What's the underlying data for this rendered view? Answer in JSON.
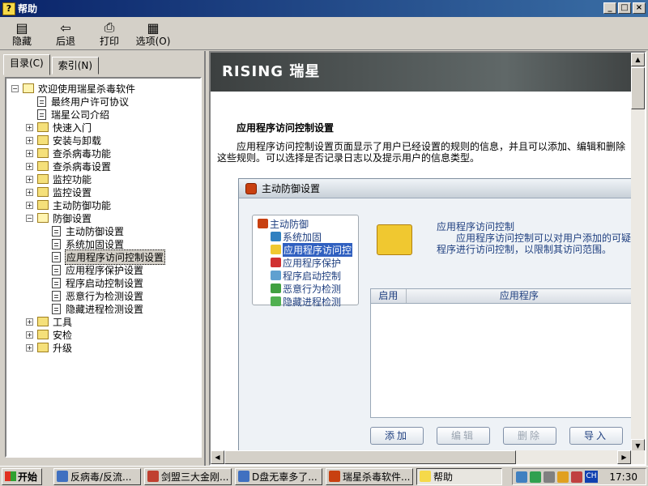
{
  "window": {
    "title": "帮助",
    "min": "_",
    "max": "□",
    "close": "×"
  },
  "toolbar": [
    {
      "label": "隐藏",
      "icon": "hide-icon"
    },
    {
      "label": "后退",
      "icon": "back-arrow-icon"
    },
    {
      "label": "打印",
      "icon": "printer-icon"
    },
    {
      "label": "选项(O)",
      "icon": "options-icon"
    }
  ],
  "tabs": [
    {
      "label": "目录(C)",
      "active": true
    },
    {
      "label": "索引(N)",
      "active": false
    }
  ],
  "tree": [
    {
      "level": 0,
      "type": "folder",
      "expander": "−",
      "open": true,
      "label": "欢迎使用瑞星杀毒软件"
    },
    {
      "level": 1,
      "type": "doc",
      "label": "最终用户许可协议"
    },
    {
      "level": 1,
      "type": "doc",
      "label": "瑞星公司介绍"
    },
    {
      "level": 1,
      "type": "folder",
      "expander": "+",
      "label": "快速入门"
    },
    {
      "level": 1,
      "type": "folder",
      "expander": "+",
      "label": "安装与卸载"
    },
    {
      "level": 1,
      "type": "folder",
      "expander": "+",
      "label": "查杀病毒功能"
    },
    {
      "level": 1,
      "type": "folder",
      "expander": "+",
      "label": "查杀病毒设置"
    },
    {
      "level": 1,
      "type": "folder",
      "expander": "+",
      "label": "监控功能"
    },
    {
      "level": 1,
      "type": "folder",
      "expander": "+",
      "label": "监控设置"
    },
    {
      "level": 1,
      "type": "folder",
      "expander": "+",
      "label": "主动防御功能"
    },
    {
      "level": 1,
      "type": "folder",
      "expander": "−",
      "open": true,
      "label": "防御设置"
    },
    {
      "level": 2,
      "type": "doc",
      "label": "主动防御设置"
    },
    {
      "level": 2,
      "type": "doc",
      "label": "系统加固设置"
    },
    {
      "level": 2,
      "type": "doc",
      "label": "应用程序访问控制设置",
      "selected": true
    },
    {
      "level": 2,
      "type": "doc",
      "label": "应用程序保护设置"
    },
    {
      "level": 2,
      "type": "doc",
      "label": "程序启动控制设置"
    },
    {
      "level": 2,
      "type": "doc",
      "label": "恶意行为检测设置"
    },
    {
      "level": 2,
      "type": "doc",
      "label": "隐藏进程检测设置"
    },
    {
      "level": 1,
      "type": "folder",
      "expander": "+",
      "label": "工具"
    },
    {
      "level": 1,
      "type": "folder",
      "expander": "+",
      "label": "安检"
    },
    {
      "level": 1,
      "type": "folder",
      "expander": "+",
      "label": "升级"
    }
  ],
  "content": {
    "banner": "RISING 瑞星",
    "heading": "应用程序访问控制设置",
    "paragraph": "应用程序访问控制设置页面显示了用户已经设置的规则的信息，并且可以添加、编辑和删除这些规则。可以选择是否记录日志以及提示用户的信息类型。",
    "screenshot": {
      "title": "主动防御设置",
      "tree": [
        {
          "label": "主动防御",
          "level": 0
        },
        {
          "label": "系统加固",
          "level": 1
        },
        {
          "label": "应用程序访问控",
          "level": 1,
          "selected": true
        },
        {
          "label": "应用程序保护",
          "level": 1
        },
        {
          "label": "程序启动控制",
          "level": 1
        },
        {
          "label": "恶意行为检测",
          "level": 1
        },
        {
          "label": "隐藏进程检测",
          "level": 1
        }
      ],
      "info_title": "应用程序访问控制",
      "info_text": "应用程序访问控制可以对用户添加的可疑程序进行访问控制，以限制其访问范围。",
      "columns": [
        "启用",
        "应用程序"
      ],
      "buttons": [
        {
          "label": "添加",
          "disabled": false
        },
        {
          "label": "编辑",
          "disabled": true
        },
        {
          "label": "删除",
          "disabled": true
        },
        {
          "label": "导入",
          "disabled": false
        }
      ]
    }
  },
  "taskbar": {
    "start": "开始",
    "tasks": [
      {
        "label": "反病毒/反流...",
        "color": "#4070c0"
      },
      {
        "label": "剑盟三大金刚...",
        "color": "#c04030",
        "active": false
      },
      {
        "label": "D盘无辜多了...",
        "color": "#4070c0"
      },
      {
        "label": "瑞星杀毒软件...",
        "color": "#c84010"
      },
      {
        "label": "帮助",
        "color": "#f5d94a",
        "active": true
      }
    ],
    "lang": "CH",
    "clock": "17:30"
  }
}
